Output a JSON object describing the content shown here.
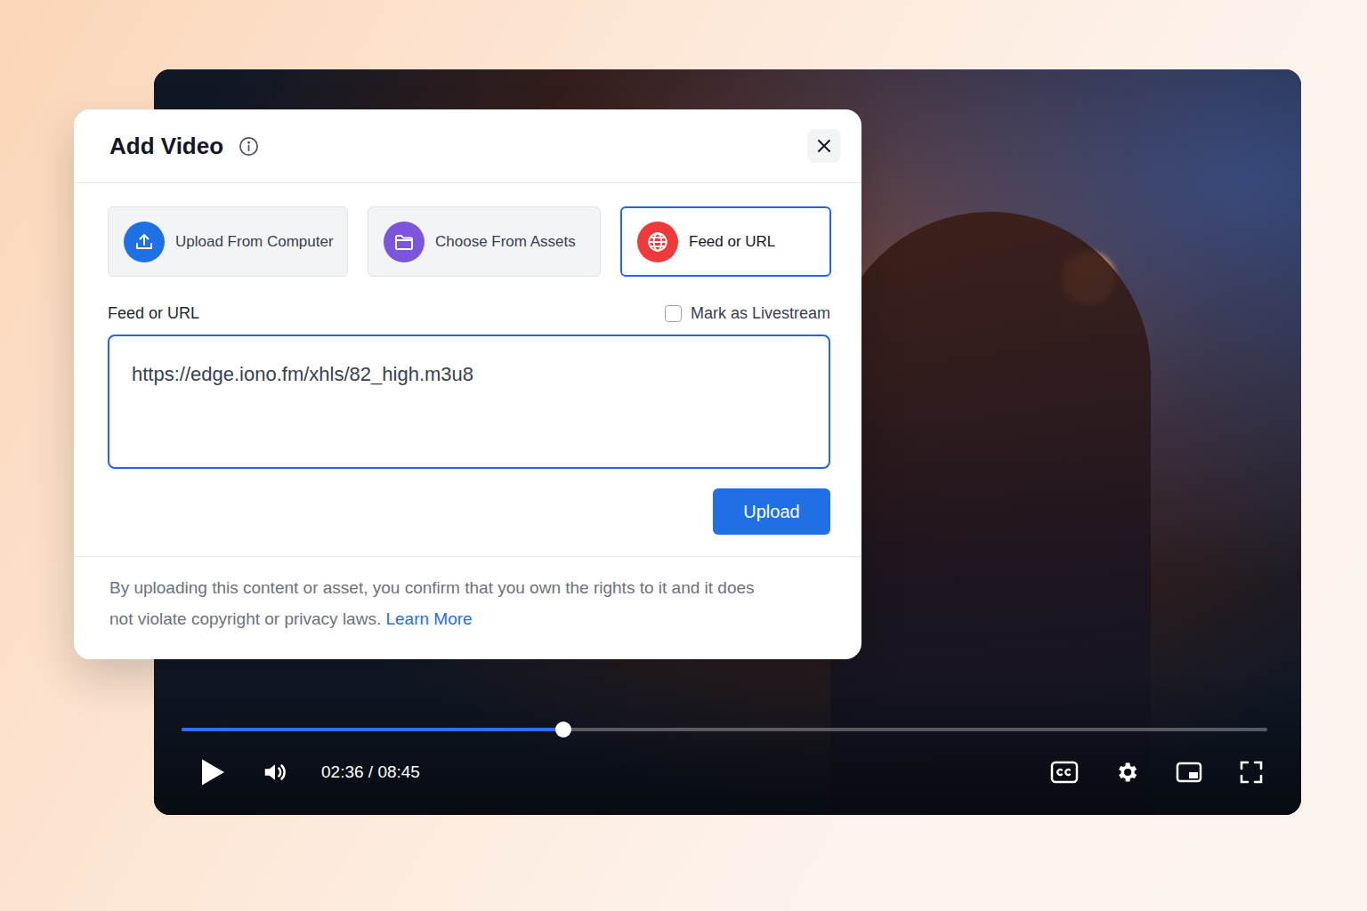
{
  "dialog": {
    "title": "Add Video"
  },
  "source_tabs": [
    {
      "label": "Upload From Computer",
      "selected": false,
      "color": "#1f6fe5",
      "kind": "upload"
    },
    {
      "label": "Choose From Assets",
      "selected": false,
      "color": "#7c55dc",
      "kind": "folder"
    },
    {
      "label": "Feed or URL",
      "selected": true,
      "color": "#ee3a3a",
      "kind": "globe"
    }
  ],
  "field": {
    "label": "Feed or URL",
    "value": "https://edge.iono.fm/xhls/82_high.m3u8"
  },
  "livestream": {
    "label": "Mark as Livestream",
    "checked": false
  },
  "upload_button": "Upload",
  "disclaimer": {
    "text": "By uploading this content or asset, you confirm that you own the rights to it and it does not violate copyright or privacy laws.",
    "link": "Learn More"
  },
  "player": {
    "time": "02:36 / 08:45",
    "level": 0.352,
    "playing": false
  }
}
